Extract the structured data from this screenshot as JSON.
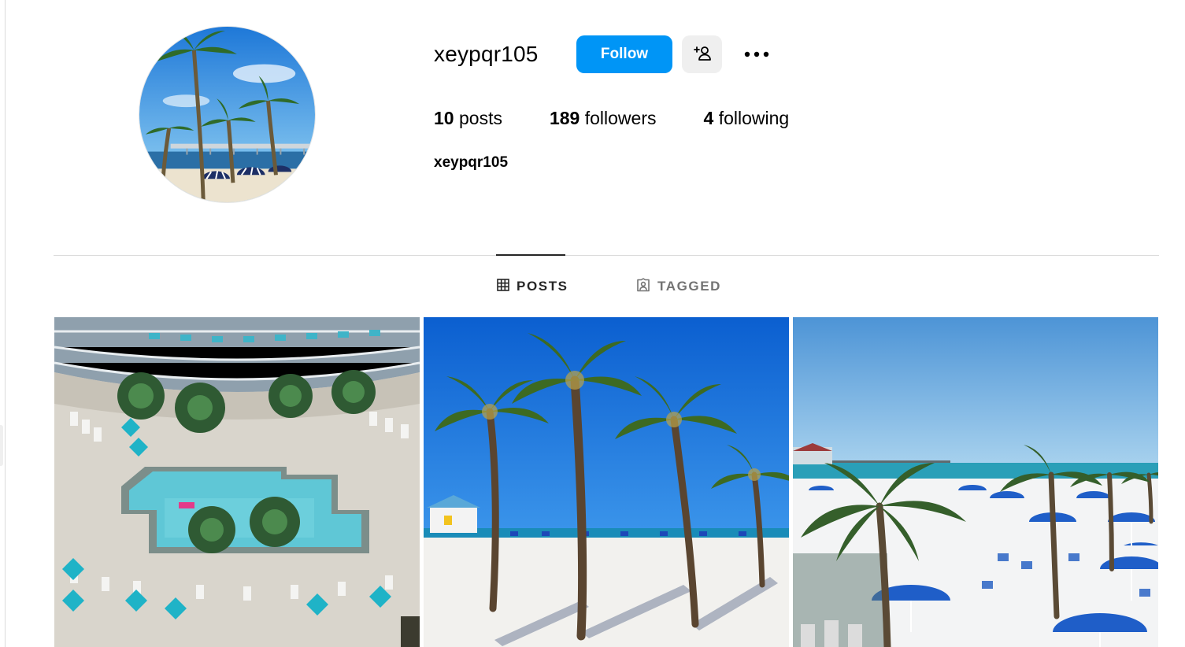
{
  "profile": {
    "username": "xeypqr105",
    "full_name": "xeypqr105",
    "follow_label": "Follow",
    "avatar_icon": "avatar-photo-palm-beach"
  },
  "stats": {
    "posts_count": "10",
    "posts_label": "posts",
    "followers_count": "189",
    "followers_label": "followers",
    "following_count": "4",
    "following_label": "following"
  },
  "tabs": {
    "posts_label": "POSTS",
    "tagged_label": "TAGGED",
    "active": "POSTS"
  },
  "icons": {
    "suggest": "add-person-icon",
    "more": "more-options-icon",
    "posts_tab": "grid-icon",
    "tagged_tab": "tagged-icon"
  },
  "colors": {
    "accent": "#0095f6",
    "secondary_button": "#efefef",
    "divider": "#dbdbdb",
    "muted_text": "#737373"
  },
  "posts": [
    {
      "subject": "aerial-hotel-pool"
    },
    {
      "subject": "palm-trees-beach"
    },
    {
      "subject": "beach-blue-umbrellas"
    }
  ]
}
